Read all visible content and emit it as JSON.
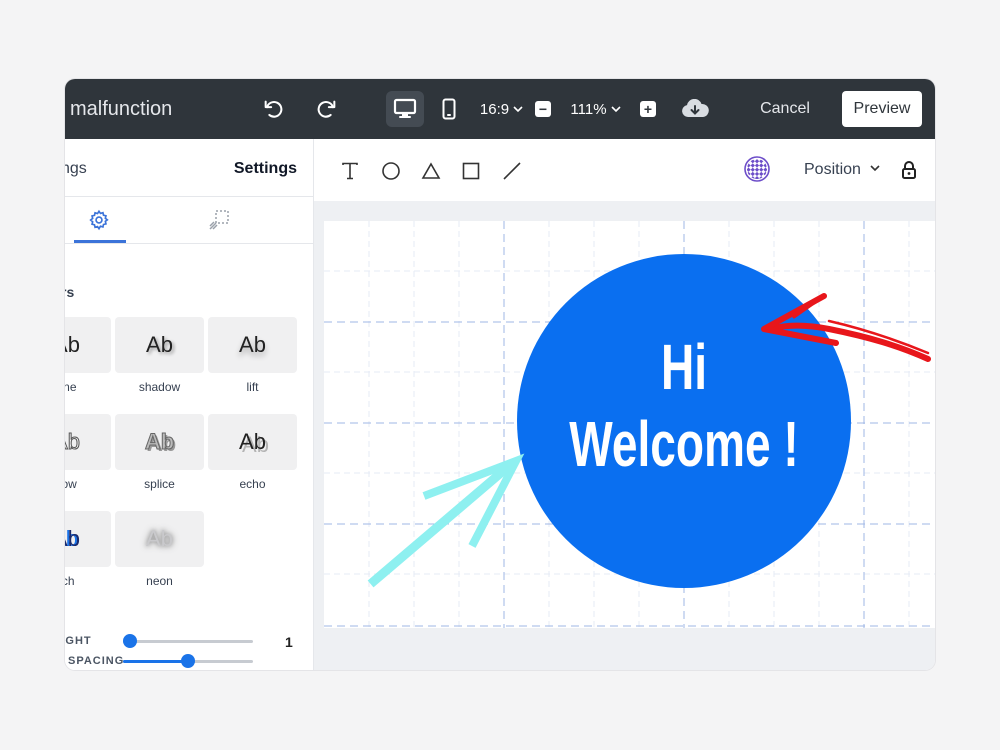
{
  "topbar": {
    "doc_title": "malfunction",
    "aspect_ratio": "16:9",
    "zoom": "111%",
    "cancel_label": "Cancel",
    "preview_label": "Preview",
    "icons": [
      "undo-icon",
      "redo-icon",
      "desktop-icon",
      "mobile-icon",
      "chevron-down-icon",
      "minus-icon",
      "plus-icon",
      "cloud-download-icon"
    ]
  },
  "sidebar": {
    "header_left": "tings",
    "header_right": "Settings",
    "section_title": "rs",
    "effects": [
      {
        "label": "one",
        "glyph": "Ab"
      },
      {
        "label": "shadow",
        "glyph": "Ab"
      },
      {
        "label": "lift",
        "glyph": "Ab"
      },
      {
        "label": "llow",
        "glyph": "Ab"
      },
      {
        "label": "splice",
        "glyph": "Ab"
      },
      {
        "label": "echo",
        "glyph": "Ab"
      },
      {
        "label": "tch",
        "glyph": "Ab"
      },
      {
        "label": "neon",
        "glyph": "Ab"
      }
    ],
    "sliders": [
      {
        "label": "EIGHT",
        "value_text": "1",
        "fraction": 0.05
      },
      {
        "label": "SPACING",
        "value_text": "",
        "fraction": 0.5
      }
    ]
  },
  "toolbar2": {
    "position_label": "Position",
    "tools": [
      "text-tool-icon",
      "circle-tool-icon",
      "triangle-tool-icon",
      "square-tool-icon",
      "line-tool-icon"
    ]
  },
  "canvas": {
    "line1": "Hi",
    "line2": "Welcome !",
    "circle_color": "#0a6ff0",
    "red_arrow_color": "#e8161b",
    "cyan_arrow_color": "#8ef0f0"
  }
}
